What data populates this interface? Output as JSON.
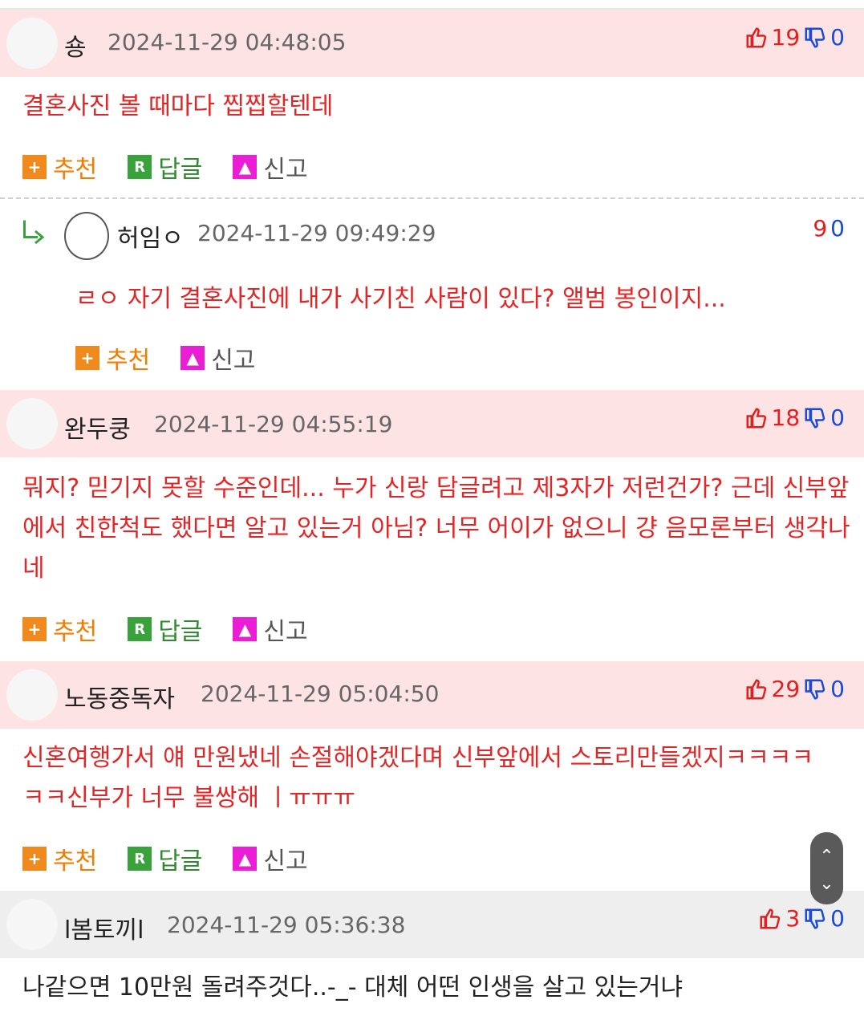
{
  "comments": [
    {
      "nick": "숑",
      "time": "2024-11-29 04:48:05",
      "up": "19",
      "down": "0",
      "text": "결혼사진 볼 때마다 찝찝할텐데"
    },
    {
      "nick": "허임ㅇ",
      "time": "2024-11-29 09:49:29",
      "up": "9",
      "down": "0",
      "text": "ㄹㅇ 자기 결혼사진에 내가 사기친 사람이 있다? 앨범 봉인이지..."
    },
    {
      "nick": "완두쿵",
      "time": "2024-11-29 04:55:19",
      "up": "18",
      "down": "0",
      "text": "뭐지? 믿기지 못할 수준인데... 누가 신랑 담글려고 제3자가 저런건가? 근데 신부앞에서 친한척도 했다면 알고 있는거 아님? 너무 어이가 없으니 걍 음모론부터 생각나네"
    },
    {
      "nick": "노동중독자",
      "time": "2024-11-29 05:04:50",
      "up": "29",
      "down": "0",
      "text": "신혼여행가서 얘 만원냈네 손절해야겠다며 신부앞에서 스토리만들겠지ㅋㅋㅋㅋㅋㅋ신부가 너무 불쌍해 ㅣㅠㅠㅠ"
    },
    {
      "nick": "l봄토끼l",
      "time": "2024-11-29 05:36:38",
      "up": "3",
      "down": "0",
      "text": "나같으면 10만원 돌려주것다..-_- 대체 어떤 인생을 살고 있는거냐"
    }
  ],
  "actions": {
    "recommend": "추천",
    "reply": "답글",
    "report": "신고"
  },
  "icons": {
    "plus": "plus-icon",
    "reply": "reply-r-icon",
    "siren": "siren-icon",
    "up": "thumbs-up-icon",
    "down": "thumbs-down-icon",
    "reply_arrow": "reply-arrow-icon"
  },
  "scroll": {
    "up": "⌃",
    "down": "⌄"
  },
  "colors": {
    "header_pink": "#fde3e3",
    "header_gray": "#eeeeee",
    "body_red": "#e02626",
    "up_red": "#e02020",
    "down_blue": "#1a4bd6"
  }
}
